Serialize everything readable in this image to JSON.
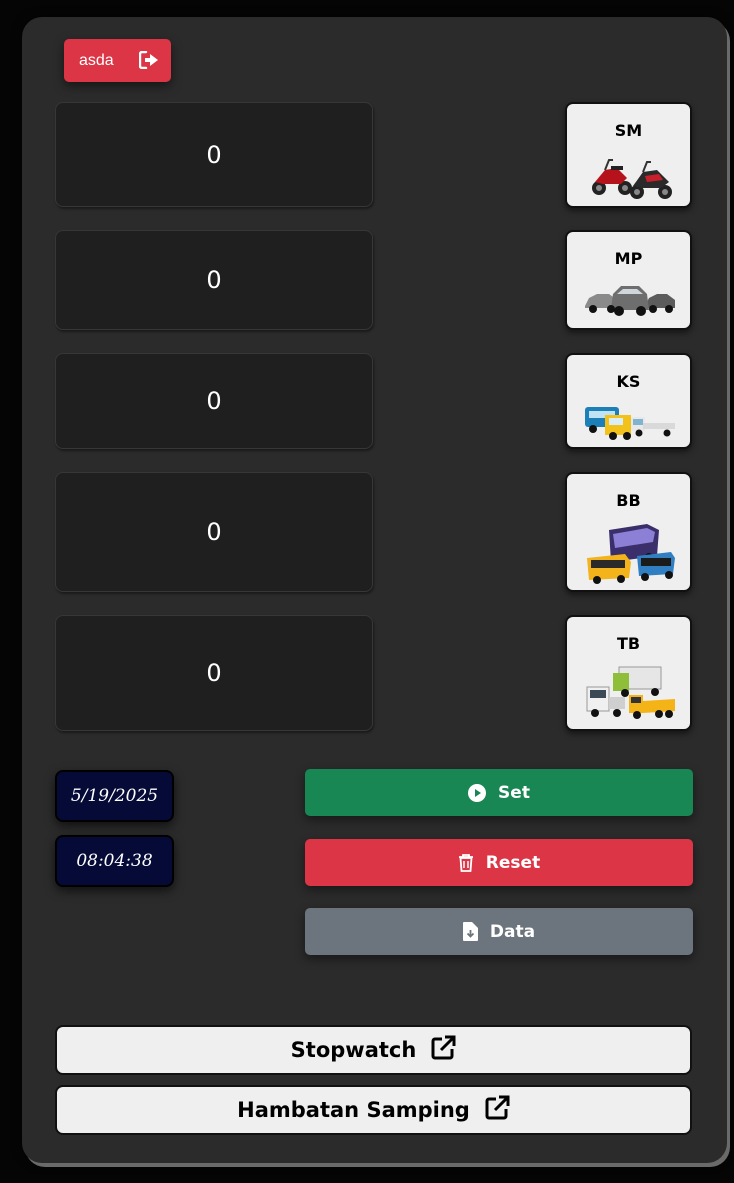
{
  "user": {
    "name": "asda",
    "icon": "logout-icon",
    "color": "#dc3545"
  },
  "counters": [
    {
      "value": "0"
    },
    {
      "value": "0"
    },
    {
      "value": "0"
    },
    {
      "value": "0"
    },
    {
      "value": "0"
    }
  ],
  "vehicles": [
    {
      "label": "SM",
      "icon": "motorcycle-image"
    },
    {
      "label": "MP",
      "icon": "car-image"
    },
    {
      "label": "KS",
      "icon": "light-truck-image"
    },
    {
      "label": "BB",
      "icon": "bus-image"
    },
    {
      "label": "TB",
      "icon": "heavy-truck-image"
    }
  ],
  "clock": {
    "date": "5/19/2025",
    "time": "08:04:38",
    "bg_color": "#050a36"
  },
  "actions": {
    "set": {
      "label": "Set",
      "icon": "play-circle-icon",
      "color": "#198754"
    },
    "reset": {
      "label": "Reset",
      "icon": "trash-icon",
      "color": "#dc3545"
    },
    "data": {
      "label": "Data",
      "icon": "file-download-icon",
      "color": "#6c757d"
    }
  },
  "links": {
    "stopwatch": {
      "label": "Stopwatch",
      "icon": "external-link-icon"
    },
    "hambatan": {
      "label": "Hambatan Samping",
      "icon": "external-link-icon"
    }
  }
}
